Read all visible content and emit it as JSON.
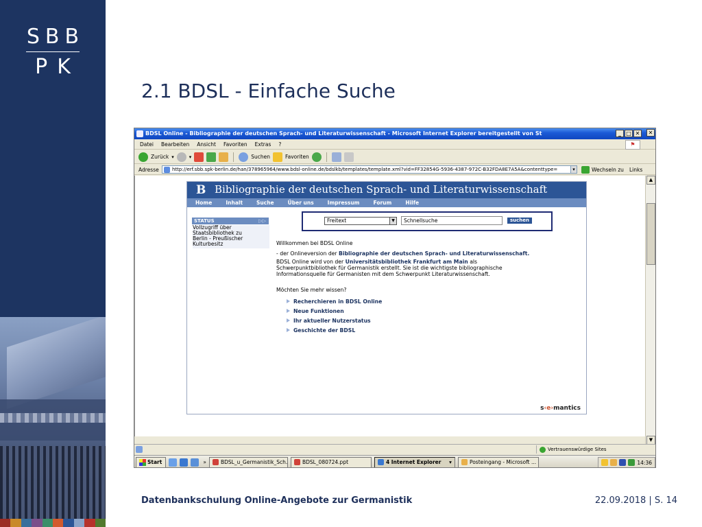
{
  "slide": {
    "logo_line1": "SBB",
    "logo_line2": "PK",
    "title": "2.1 BDSL - Einfache Suche",
    "footer_left": "Datenbankschulung Online-Angebote zur Germanistik",
    "footer_right": "22.09.2018 | S. 14",
    "colorbar": [
      "#9b2d24",
      "#c98a2a",
      "#3a6f9b",
      "#7a4f8a",
      "#3b8f6a",
      "#d25a2e",
      "#2c5596",
      "#8aa3c8",
      "#b6322b",
      "#517a2e"
    ]
  },
  "ie": {
    "window_title": "BDSL Online - Bibliographie der deutschen Sprach- und Literaturwissenschaft - Microsoft Internet Explorer bereitgestellt von St",
    "menu": [
      "Datei",
      "Bearbeiten",
      "Ansicht",
      "Favoriten",
      "Extras",
      "?"
    ],
    "toolbar": {
      "back": "Zurück",
      "search": "Suchen",
      "favorites": "Favoriten"
    },
    "address_label": "Adresse",
    "address_url": "http://erf.sbb.spk-berlin.de/han/378965964/www.bdsl-online.de/bdslkb/templates/template.xml?vid=FF32854G-5936-4387-972C-B32FDA8E7A5A&contenttype=",
    "go_label": "Wechseln zu",
    "links_label": "Links",
    "status_zone": "Vertrauenswürdige Sites"
  },
  "taskbar": {
    "start": "Start",
    "overflow": "»",
    "tasks": [
      "BDSL_u_Germanistik_Sch...",
      "BDSL_080724.ppt",
      "4 Internet Explorer",
      "Posteingang - Microsoft ..."
    ],
    "clock": "14:36"
  },
  "bdsl": {
    "logo_letter": "B",
    "site_title": "Bibliographie der deutschen Sprach- und Literaturwissenschaft",
    "nav": [
      "Home",
      "Inhalt",
      "Suche",
      "Über uns",
      "Impressum",
      "Forum",
      "Hilfe"
    ],
    "status_label": "STATUS",
    "status_arrows": "▷▷",
    "status_lines": [
      "Vollzugriff über",
      "Staatsbibliothek zu",
      "Berlin - Preußischer",
      "Kulturbesitz"
    ],
    "search": {
      "field": "Freitext",
      "placeholder": "Schnellsuche",
      "button": "suchen"
    },
    "welcome": "Willkommen bei BDSL Online",
    "intro_prefix": "- der Onlineversion der ",
    "intro_bold": "Bibliographie der deutschen Sprach- und Literaturwissenschaft.",
    "p2_prefix": "BDSL Online wird von der ",
    "p2_bold": "Universitätsbibliothek Frankfurt am Main",
    "p2_suffix": " als",
    "p2_line2": "Schwerpunktbibliothek für Germanistik erstellt. Sie ist die wichtigste bibliographische",
    "p2_line3": "Informationsquelle für Germanisten mit dem Schwerpunkt Literaturwissenschaft.",
    "more": "Möchten Sie mehr wissen?",
    "links": [
      "Recherchieren in BDSL Online",
      "Neue Funktionen",
      "Ihr aktueller Nutzerstatus",
      "Geschichte der BDSL"
    ],
    "brand_part1": "s",
    "brand_part2": "‹e›",
    "brand_part3": "mantics"
  }
}
